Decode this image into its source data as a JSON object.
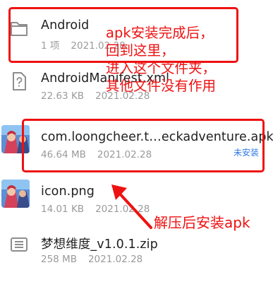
{
  "files": [
    {
      "name": "Android",
      "meta_left": "1 项",
      "date": "2021.02.28",
      "icon": "folder-icon"
    },
    {
      "name": "AndroidManifest.xml",
      "meta_left": "22.63 KB",
      "date": "2021.02.28",
      "icon": "unknown-file-icon"
    },
    {
      "name": "com.loongcheer.t…eckadventure.apk",
      "meta_left": "46.64 MB",
      "date": "2021.02.28",
      "icon": "app-icon",
      "status": "未安装"
    },
    {
      "name": "icon.png",
      "meta_left": "14.01 KB",
      "date": "2021.02.28",
      "icon": "image-thumbnail-icon"
    },
    {
      "name": "梦想维度_v1.0.1.zip",
      "meta_left": "258 MB",
      "date": "2021.02.28",
      "icon": "archive-icon"
    }
  ],
  "annotations": {
    "top_lines": [
      "apk安装完成后，",
      "回到这里，",
      "进入这个文件夹，",
      "其他文件没有作用"
    ],
    "bottom": "解压后安装apk"
  },
  "colors": {
    "annotation_red": "#ee1111",
    "status_blue": "#2f7ae6",
    "meta_gray": "#9a9a9a"
  }
}
